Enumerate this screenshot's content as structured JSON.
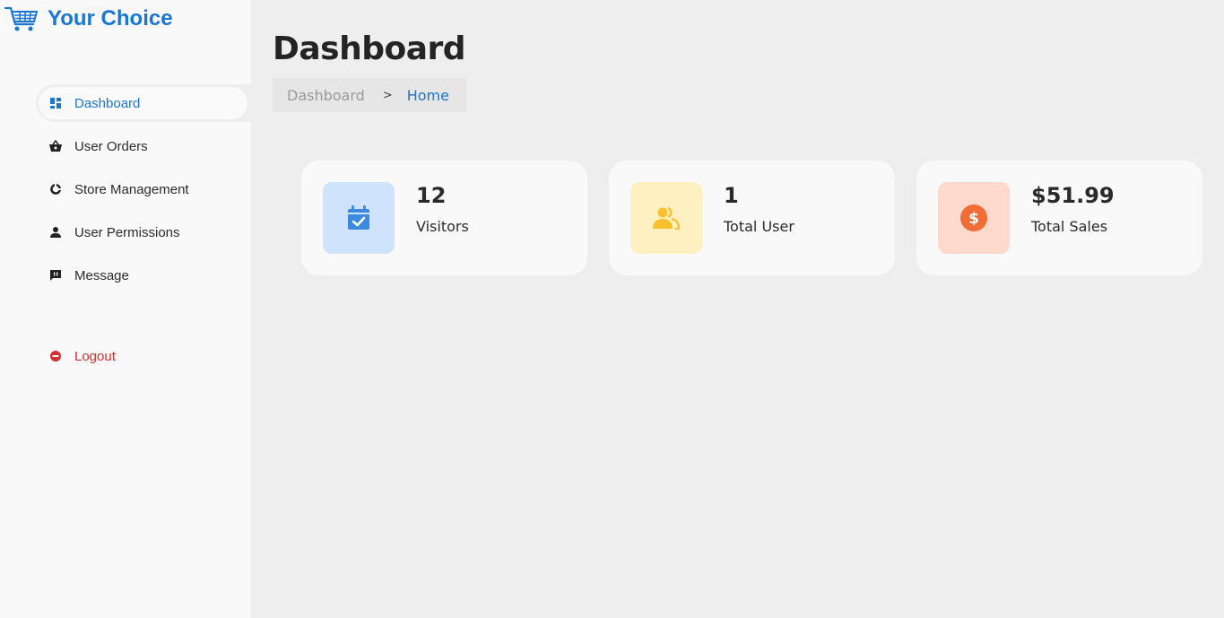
{
  "brand": {
    "title": "Your Choice",
    "icon": "shopping-cart-icon",
    "color": "#1976d2"
  },
  "sidebar": {
    "items": [
      {
        "label": "Dashboard",
        "icon": "grid-icon"
      },
      {
        "label": "User Orders",
        "icon": "basket-icon"
      },
      {
        "label": "Store Management",
        "icon": "pie-chart-icon"
      },
      {
        "label": "User Permissions",
        "icon": "person-icon"
      },
      {
        "label": "Message",
        "icon": "message-icon"
      }
    ],
    "logout": {
      "label": "Logout",
      "icon": "no-entry-icon",
      "color": "#d32f2f"
    }
  },
  "main": {
    "title": "Dashboard",
    "breadcrumb": {
      "parent": "Dashboard",
      "separator": ">",
      "current": "Home"
    },
    "cards": [
      {
        "value": "12",
        "label": "Visitors",
        "icon": "calendar-check-icon",
        "bg": "#cfe4fc",
        "fg": "#3d8be0"
      },
      {
        "value": "1",
        "label": "Total User",
        "icon": "users-icon",
        "bg": "#fff0c2",
        "fg": "#fbc02d"
      },
      {
        "value": "$51.99",
        "label": "Total Sales",
        "icon": "dollar-circle-icon",
        "bg": "#ffd9cc",
        "fg": "#f26d36"
      }
    ]
  }
}
